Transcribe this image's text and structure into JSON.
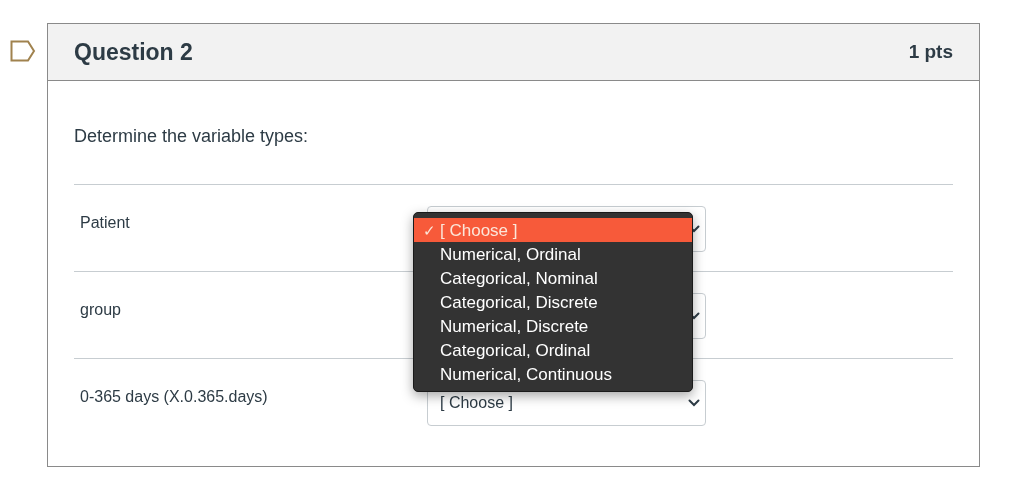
{
  "question": {
    "title": "Question 2",
    "points": "1 pts",
    "prompt": "Determine the variable types:"
  },
  "rows": [
    {
      "label": "Patient",
      "value": "",
      "open": true
    },
    {
      "label": "group",
      "value": "",
      "open": false
    },
    {
      "label": "0-365 days (X.0.365.days)",
      "value": "[ Choose ]",
      "open": false
    }
  ],
  "dropdown": {
    "check": "✓",
    "options": [
      {
        "label": "[ Choose ]",
        "selected": true
      },
      {
        "label": "Numerical, Ordinal",
        "selected": false
      },
      {
        "label": "Categorical, Nominal",
        "selected": false
      },
      {
        "label": "Categorical, Discrete",
        "selected": false
      },
      {
        "label": "Numerical, Discrete",
        "selected": false
      },
      {
        "label": "Categorical, Ordinal",
        "selected": false
      },
      {
        "label": "Numerical, Continuous",
        "selected": false
      }
    ]
  }
}
